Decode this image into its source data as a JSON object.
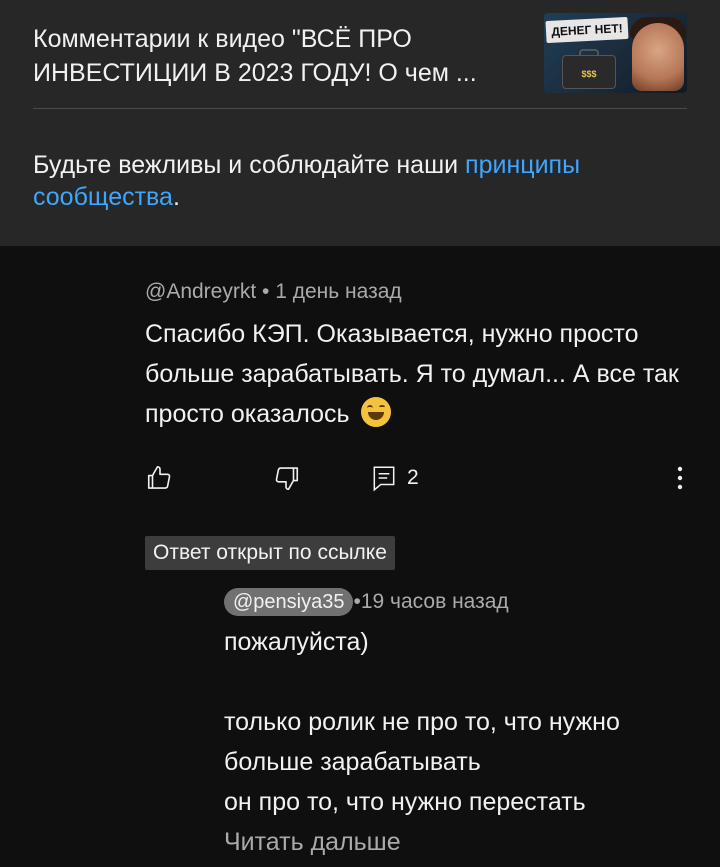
{
  "header": {
    "title": "Комментарии к видео \"ВСЁ ПРО ИНВЕСТИЦИИ В 2023 ГОДУ! О чем ...",
    "thumbnail": {
      "banner_text": "ДЕНЕГ НЕТ!",
      "case_label": "$$$"
    },
    "guideline_text": "Будьте вежливы и соблюдайте наши ",
    "guideline_link": "принципы сообщества",
    "guideline_end": "."
  },
  "comment": {
    "author": "@Andreyrkt",
    "separator": " • ",
    "time": "1 день назад",
    "text": "Спасибо КЭП. Оказывается, нужно просто больше зарабатывать. Я то думал... А все так просто оказалось",
    "emoji": "grinning-squinting-face",
    "reply_count": "2"
  },
  "linked_badge": "Ответ открыт по ссылке",
  "reply": {
    "author": "@pensiya35",
    "separator": " • ",
    "time": "19 часов назад",
    "text": "пожалуйста)\n\nтолько ролик не про то, что нужно больше зарабатывать\nон про то, что нужно перестать",
    "read_more": "Читать дальше"
  },
  "colors": {
    "header_bg": "#272727",
    "page_bg": "#0f0f0f",
    "link": "#3ea6ff",
    "muted": "#aaaaaa"
  }
}
